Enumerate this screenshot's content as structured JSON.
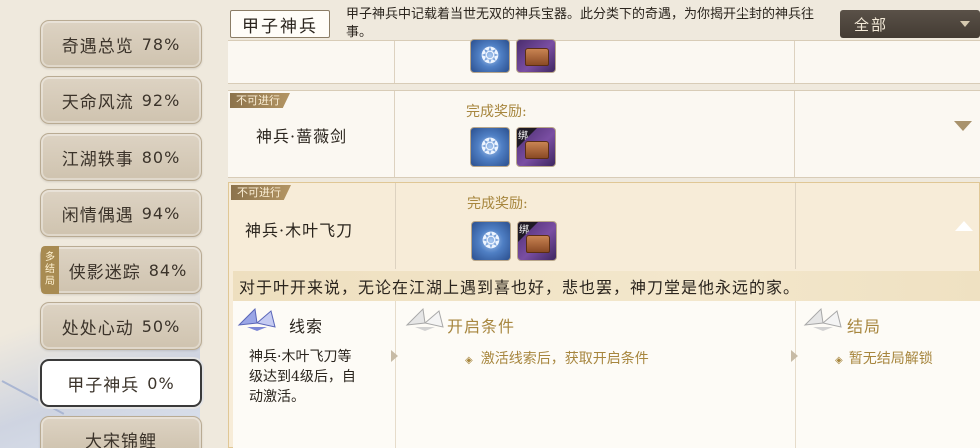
{
  "sidebar": {
    "items": [
      {
        "label": "奇遇总览",
        "pct": "78%"
      },
      {
        "label": "天命风流",
        "pct": "92%"
      },
      {
        "label": "江湖轶事",
        "pct": "80%"
      },
      {
        "label": "闲情偶遇",
        "pct": "94%"
      },
      {
        "label": "侠影迷踪",
        "pct": "84%",
        "tag": [
          "多",
          "结",
          "局"
        ]
      },
      {
        "label": "处处心动",
        "pct": "50%"
      },
      {
        "label": "甲子神兵",
        "pct": "0%"
      },
      {
        "label": "大宋锦鲤",
        "pct": ""
      }
    ]
  },
  "header": {
    "title": "甲子神兵",
    "description": "甲子神兵中记载着当世无双的神兵宝器。此分类下的奇遇，为你揭开尘封的神兵往事。",
    "filter_value": "全部"
  },
  "rows": [
    {
      "badge": "不可进行",
      "name": "神兵·蔷薇剑",
      "reward_label": "完成奖励:",
      "bind_label": "绑"
    },
    {
      "badge": "不可进行",
      "name": "神兵·木叶飞刀",
      "reward_label": "完成奖励:",
      "bind_label": "绑",
      "quote": "对于叶开来说，无论在江湖上遇到喜也好，悲也罢，神刀堂是他永远的家。",
      "clue": {
        "title": "线索",
        "text_lines": [
          "神兵·木叶飞刀等",
          "级达到4级后，自",
          "动激活。"
        ]
      },
      "condition": {
        "title": "开启条件",
        "text": "激活线索后，获取开启条件"
      },
      "ending": {
        "title": "结局",
        "text": "暂无结局解锁"
      }
    }
  ],
  "colors": {
    "accent_gold": "#a7863e",
    "badge_brown": "#8c734c",
    "dropdown_dark": "#4a423a"
  }
}
